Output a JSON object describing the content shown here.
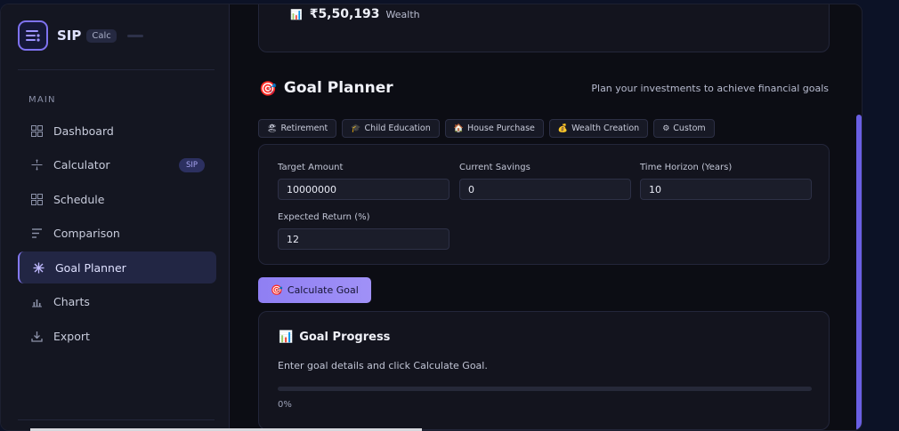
{
  "brand": {
    "name": "SIP",
    "badge": "Calc"
  },
  "sidebar": {
    "section": "MAIN",
    "items": [
      {
        "label": "Dashboard",
        "icon": "grid-icon"
      },
      {
        "label": "Calculator",
        "icon": "calculator-icon",
        "badge": "SIP"
      },
      {
        "label": "Schedule",
        "icon": "grid-icon"
      },
      {
        "label": "Comparison",
        "icon": "lines-icon"
      },
      {
        "label": "Goal Planner",
        "icon": "target-icon",
        "active": true
      },
      {
        "label": "Charts",
        "icon": "bar-chart-icon"
      },
      {
        "label": "Export",
        "icon": "download-icon"
      }
    ]
  },
  "summary": {
    "icon": "📊",
    "value": "₹5,50,193",
    "label": "Wealth"
  },
  "goal": {
    "icon": "🎯",
    "title": "Goal Planner",
    "subtitle": "Plan your investments to achieve financial goals",
    "chips": [
      {
        "icon": "🏖",
        "label": "Retirement"
      },
      {
        "icon": "🎓",
        "label": "Child Education"
      },
      {
        "icon": "🏠",
        "label": "House Purchase"
      },
      {
        "icon": "💰",
        "label": "Wealth Creation"
      },
      {
        "icon": "⚙",
        "label": "Custom"
      }
    ],
    "fields": {
      "target": {
        "label": "Target Amount",
        "value": "10000000"
      },
      "savings": {
        "label": "Current Savings",
        "value": "0"
      },
      "horizon": {
        "label": "Time Horizon (Years)",
        "value": "10"
      },
      "return": {
        "label": "Expected Return (%)",
        "value": "12"
      }
    },
    "button": {
      "icon": "🎯",
      "label": "Calculate Goal"
    }
  },
  "progress": {
    "icon": "📊",
    "title": "Goal Progress",
    "message": "Enter goal details and click Calculate Goal.",
    "percent_label": "0%",
    "fraction": 0
  }
}
